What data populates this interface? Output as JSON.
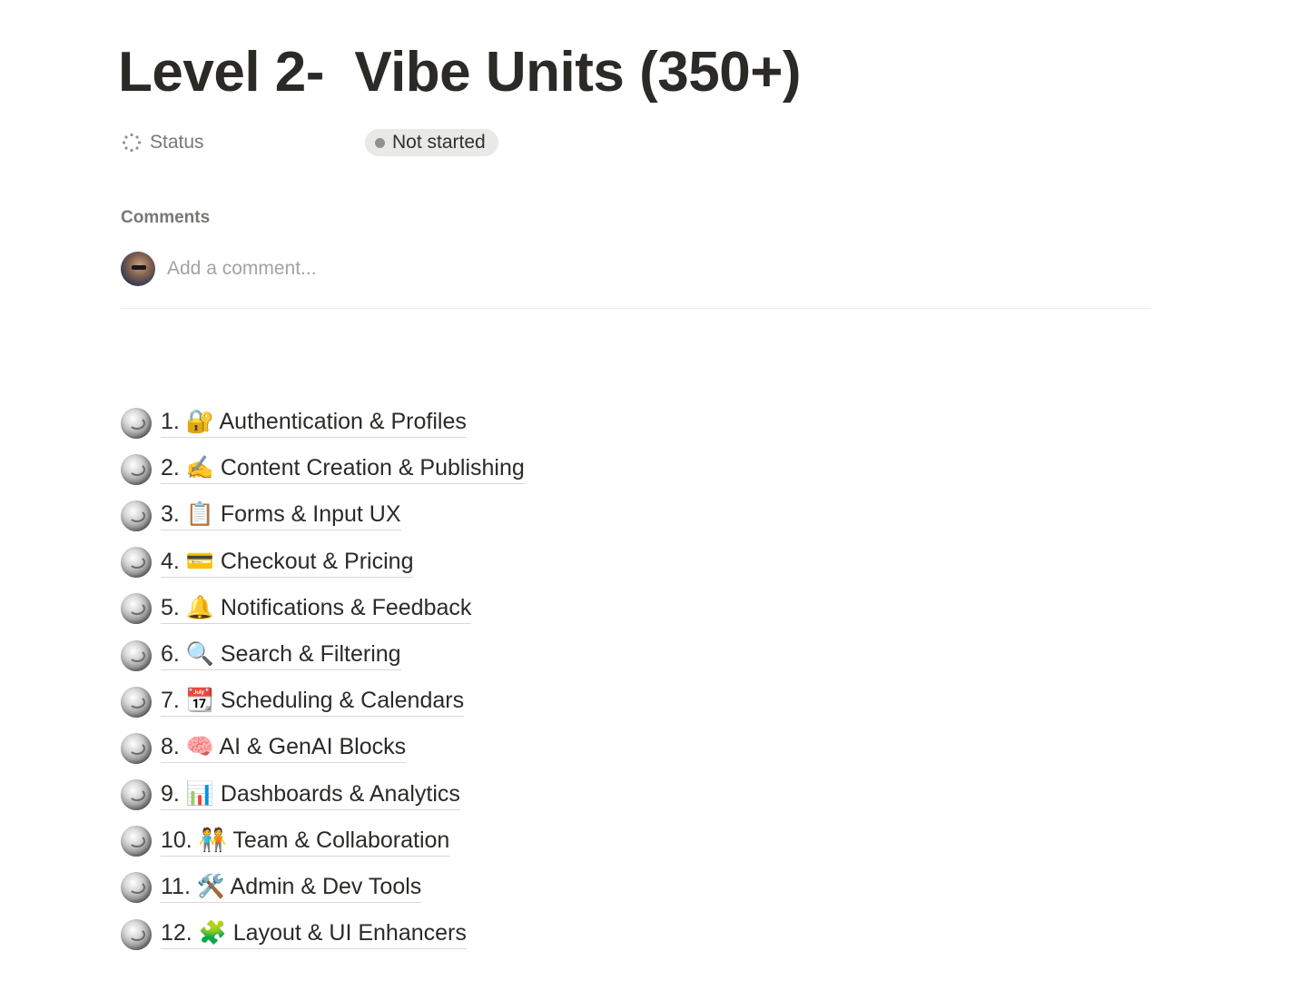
{
  "page": {
    "title": "Level 2-  Vibe Units (350+)"
  },
  "properties": {
    "status": {
      "label": "Status",
      "icon": "status-spinner-icon",
      "value": "Not started",
      "dot_color": "#91918e"
    }
  },
  "comments": {
    "label": "Comments",
    "placeholder": "Add a comment..."
  },
  "subpages": [
    {
      "title": "1. 🔐 Authentication & Profiles"
    },
    {
      "title": "2. ✍️ Content Creation & Publishing"
    },
    {
      "title": "3. 📋 Forms & Input UX"
    },
    {
      "title": "4. 💳 Checkout & Pricing"
    },
    {
      "title": "5. 🔔 Notifications & Feedback"
    },
    {
      "title": "6. 🔍 Search & Filtering"
    },
    {
      "title": "7. 📆 Scheduling & Calendars"
    },
    {
      "title": "8. 🧠 AI & GenAI Blocks"
    },
    {
      "title": "9. 📊 Dashboards & Analytics"
    },
    {
      "title": "10. 🧑‍🤝‍🧑 Team & Collaboration"
    },
    {
      "title": "11. 🛠️ Admin & Dev Tools"
    },
    {
      "title": "12. 🧩 Layout & UI Enhancers"
    }
  ]
}
